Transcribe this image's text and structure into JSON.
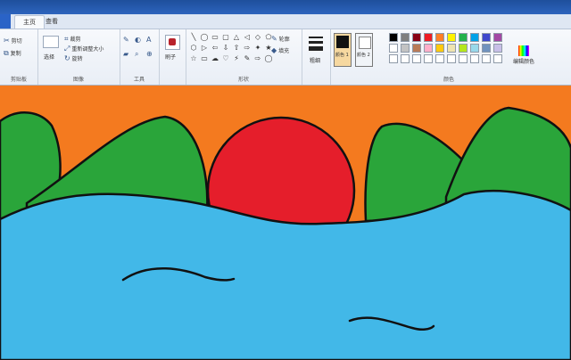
{
  "app": {
    "tabs": [
      {
        "label": "主页",
        "active": true
      },
      {
        "label": "查看",
        "active": false
      }
    ]
  },
  "ribbon": {
    "clipboard": {
      "label": "剪贴板",
      "items": [
        "剪切",
        "复制"
      ]
    },
    "image": {
      "label": "图像",
      "select_label": "选择",
      "crop_label": "裁剪",
      "resize_label": "重新调整大小",
      "rotate_label": "旋转"
    },
    "tools": {
      "label": "工具",
      "icons": [
        "pencil-icon",
        "fill-icon",
        "text-icon",
        "eraser-icon",
        "color-picker-icon",
        "magnifier-icon"
      ]
    },
    "brushes": {
      "label": "刷子"
    },
    "shapes": {
      "label": "形状",
      "outline_label": "轮廓",
      "fill_label": "填充",
      "shape_glyphs": [
        "╲",
        "◯",
        "▭",
        "▢",
        "△",
        "◁",
        "◇",
        "⬠",
        "⬡",
        "▷",
        "⇦",
        "⇩",
        "⇧",
        "⇨",
        "✦",
        "★",
        "☆",
        "▭",
        "☁",
        "♡",
        "⚡",
        "✎",
        "⇨",
        "◯"
      ]
    },
    "size": {
      "label": "粗细"
    },
    "colors": {
      "label": "颜色",
      "color1_label": "颜色 1",
      "color2_label": "颜色 2",
      "edit_colors_label": "编辑颜色",
      "color1": "#111111",
      "color2": "#ffffff",
      "palette": [
        "#000000",
        "#7f7f7f",
        "#880015",
        "#ed1c24",
        "#ff7f27",
        "#fff200",
        "#22b14c",
        "#00a2e8",
        "#3f48cc",
        "#a349a4",
        "#ffffff",
        "#c3c3c3",
        "#b97a57",
        "#ffaec9",
        "#ffc90e",
        "#efe4b0",
        "#b5e61d",
        "#99d9ea",
        "#7092be",
        "#c8bfe7",
        "#ffffff",
        "#ffffff",
        "#ffffff",
        "#ffffff",
        "#ffffff",
        "#ffffff",
        "#ffffff",
        "#ffffff",
        "#ffffff",
        "#ffffff"
      ]
    }
  },
  "canvas": {
    "colors": {
      "sky": "#f47a1f",
      "sun": "#e51e2b",
      "hills": "#2aa53a",
      "sea": "#42b8e8",
      "outline": "#111111"
    }
  }
}
